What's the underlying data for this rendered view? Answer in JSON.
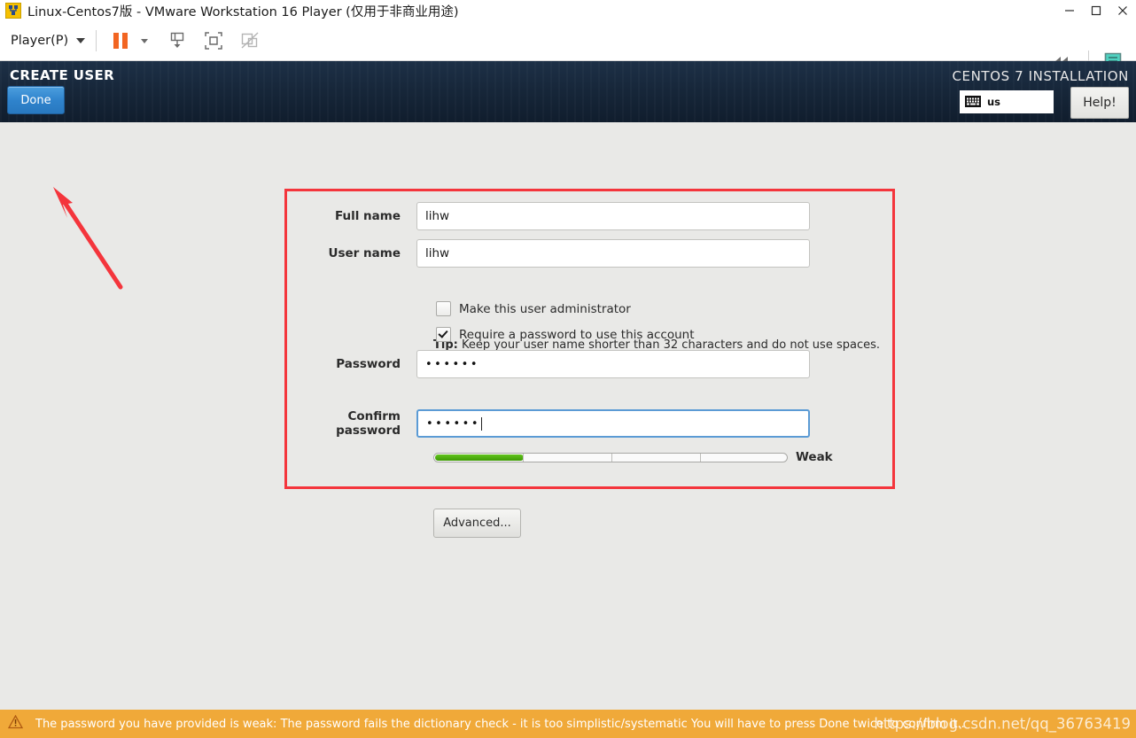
{
  "window": {
    "title": "Linux-Centos7版 - VMware Workstation 16 Player (仅用于非商业用途)",
    "app_icon": "vmware-vm-icon",
    "controls": {
      "minimize": "minimize-icon",
      "maximize": "maximize-icon",
      "close": "close-icon"
    }
  },
  "toolbar": {
    "player_menu_label": "Player(P)",
    "icons": [
      "pause-icon",
      "pause-dropdown-caret-icon",
      "send-key-icon",
      "fullscreen-icon",
      "unity-mode-disabled-icon"
    ],
    "right_icons": [
      "collapse-toolbar-icon",
      "notes-icon"
    ]
  },
  "installer": {
    "header": {
      "screen_title": "CREATE USER",
      "done_label": "Done",
      "product_title": "CENTOS 7 INSTALLATION",
      "keyboard_icon": "keyboard-icon",
      "keyboard_layout": "us",
      "help_label": "Help!"
    },
    "form": {
      "full_name": {
        "label": "Full name",
        "value": "lihw"
      },
      "user_name": {
        "label": "User name",
        "value": "lihw"
      },
      "tip_prefix": "Tip:",
      "tip_text": " Keep your user name shorter than 32 characters and do not use spaces.",
      "admin_checkbox": {
        "label": "Make this user administrator",
        "checked": false
      },
      "require_password_checkbox": {
        "label": "Require a password to use this account",
        "checked": true
      },
      "password": {
        "label": "Password",
        "value": "••••••"
      },
      "strength": {
        "label": "Weak",
        "percent": 25,
        "fill_color": "#4daa0b"
      },
      "confirm_password": {
        "label": "Confirm password",
        "value": "••••••",
        "focused": true
      },
      "advanced_label": "Advanced..."
    },
    "annotation": {
      "box_color": "#f4353c",
      "arrow_color": "#f4353c",
      "arrow_target": "done-button"
    }
  },
  "statusbar": {
    "icon": "warning-icon",
    "message": "The password you have provided is weak: The password fails the dictionary check - it is too simplistic/systematic You will have to press Done twice to confirm it..",
    "background": "#f0a939",
    "watermark": "https://blog.csdn.net/qq_36763419"
  }
}
